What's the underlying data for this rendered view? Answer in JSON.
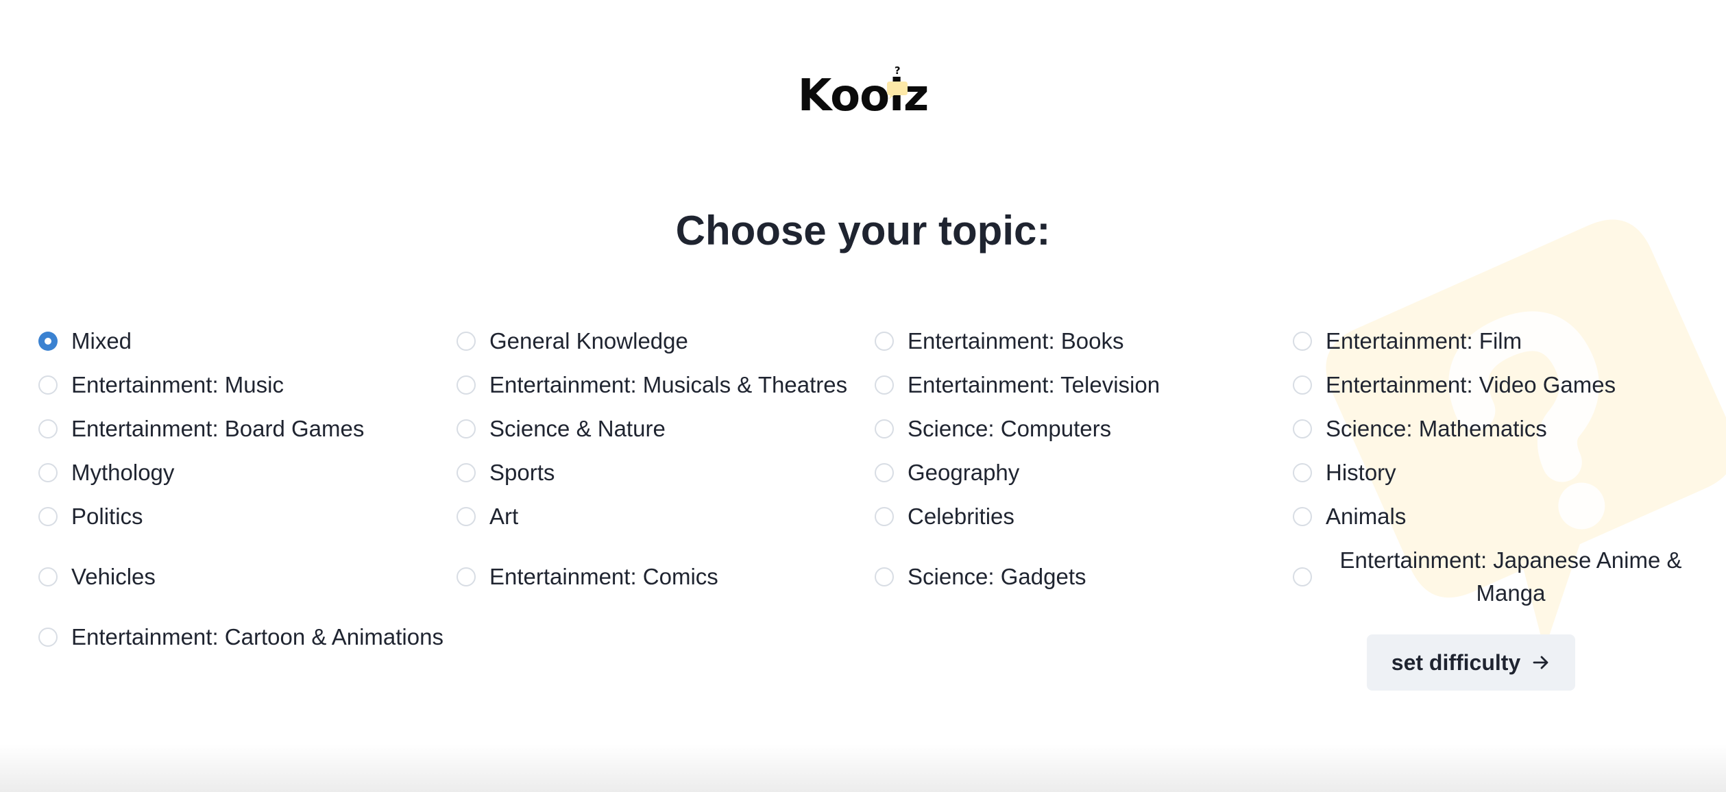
{
  "brand": {
    "name": "Kooiz",
    "bubble_mark": "?"
  },
  "heading": "Choose your topic:",
  "topics": [
    {
      "label": "Mixed",
      "checked": true
    },
    {
      "label": "General Knowledge",
      "checked": false
    },
    {
      "label": "Entertainment: Books",
      "checked": false
    },
    {
      "label": "Entertainment: Film",
      "checked": false
    },
    {
      "label": "Entertainment: Music",
      "checked": false
    },
    {
      "label": "Entertainment: Musicals & Theatres",
      "checked": false
    },
    {
      "label": "Entertainment: Television",
      "checked": false
    },
    {
      "label": "Entertainment: Video Games",
      "checked": false
    },
    {
      "label": "Entertainment: Board Games",
      "checked": false
    },
    {
      "label": "Science & Nature",
      "checked": false
    },
    {
      "label": "Science: Computers",
      "checked": false
    },
    {
      "label": "Science: Mathematics",
      "checked": false
    },
    {
      "label": "Mythology",
      "checked": false
    },
    {
      "label": "Sports",
      "checked": false
    },
    {
      "label": "Geography",
      "checked": false
    },
    {
      "label": "History",
      "checked": false
    },
    {
      "label": "Politics",
      "checked": false
    },
    {
      "label": "Art",
      "checked": false
    },
    {
      "label": "Celebrities",
      "checked": false
    },
    {
      "label": "Animals",
      "checked": false
    },
    {
      "label": "Vehicles",
      "checked": false
    },
    {
      "label": "Entertainment: Comics",
      "checked": false
    },
    {
      "label": "Science: Gadgets",
      "checked": false
    },
    {
      "label": "Entertainment: Japanese Anime & Manga",
      "checked": false
    },
    {
      "label": "Entertainment: Cartoon & Animations",
      "checked": false
    }
  ],
  "action_button": {
    "label": "set difficulty",
    "icon": "arrow-right-icon"
  },
  "colors": {
    "accent": "#3b82d1",
    "text": "#1f2430",
    "button_bg": "#eef1f5",
    "decoration": "#fff8e6",
    "logo_bubble": "#fde9a8"
  }
}
